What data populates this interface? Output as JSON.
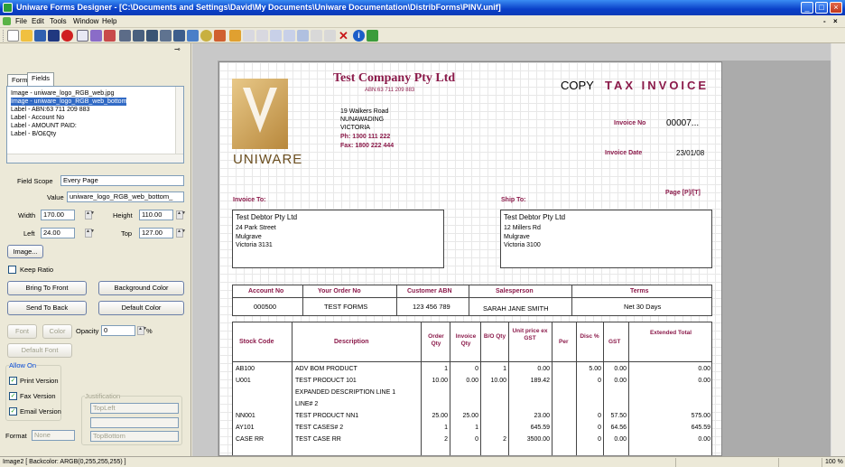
{
  "window": {
    "title": "Uniware Forms Designer - [C:\\Documents and Settings\\David\\My Documents\\Uniware Documentation\\DistribForms\\PINV.unif]",
    "min": "_",
    "max": "□",
    "close": "×"
  },
  "menu": {
    "items": [
      "File",
      "Edit",
      "Tools",
      "Window",
      "Help"
    ],
    "mdi_minimize": "-",
    "mdi_close": "×"
  },
  "toolbar": {
    "icons": [
      "new-icon",
      "open-icon",
      "save-icon",
      "save-as-icon",
      "delete-icon",
      "print-preview-icon",
      "cut-icon",
      "print-icon",
      "field-icon",
      "grid-icon",
      "table-icon",
      "label-icon",
      "image-icon",
      "chart-icon",
      "compass-icon",
      "align-icon",
      "pointer-icon",
      "undo-icon",
      "redo-icon",
      "zoom-in-icon",
      "zoom-out-icon",
      "wand-icon",
      "copy-icon",
      "paste-icon",
      "delete-x-icon",
      "info-icon",
      "exit-icon"
    ]
  },
  "colors": {
    "accent": "#8b1a4a",
    "selection": "#316ac5",
    "title_bar": "#0a3fc8"
  },
  "panel": {
    "tabs": [
      "Form",
      "Fields"
    ],
    "fields": [
      "Image - uniware_logo_RGB_web.jpg",
      "Image - uniware_logo_RGB_web_bottom",
      "Label - ABN:63 711 209 883",
      "Label - Account No",
      "Label - AMOUNT PAID:",
      "Label - B/O£Qty"
    ],
    "selected_field_index": 1,
    "field_scope_label": "Field Scope",
    "field_scope": "Every Page",
    "value_label": "Value",
    "value": "uniware_logo_RGB_web_bottom_",
    "width_label": "Width",
    "width": "170.00",
    "height_label": "Height",
    "height": "110.00",
    "left_label": "Left",
    "left": "24.00",
    "top_label": "Top",
    "top": "127.00",
    "image_button": "Image...",
    "keep_ratio": "Keep Ratio",
    "bring_front": "Bring To Front",
    "background_color": "Background Color",
    "send_back": "Send To Back",
    "default_color": "Default Color",
    "font": "Font",
    "color": "Color",
    "opacity_label": "Opacity",
    "opacity": "0",
    "percent": "%",
    "default_font": "Default Font",
    "allow_on": "Allow On",
    "print_version": "Print Version",
    "fax_version": "Fax Version",
    "email_version": "Email Version",
    "justification": "Justification",
    "just_h": "TopLeft",
    "just_v": "TopBottom",
    "format_label": "Format",
    "format": "None"
  },
  "invoice": {
    "company": "Test Company Pty Ltd",
    "abn": "ABN:63 711 209 883",
    "address": [
      "19 Walkers Road",
      "NUNAWADING",
      "VICTORIA"
    ],
    "phone": "Ph: 1300 111 222",
    "fax": "Fax: 1800 222 444",
    "logo_text": "UNIWARE",
    "copy": "COPY",
    "doc_title": "TAX INVOICE",
    "invoice_no_label": "Invoice No",
    "invoice_no": "00007...",
    "invoice_date_label": "Invoice Date",
    "invoice_date": "23/01/08",
    "page": "Page [P]/[T]",
    "invoice_to_label": "Invoice To:",
    "invoice_to": [
      "Test Debtor Pty Ltd",
      "24 Park Street",
      "Mulgrave",
      "Victoria  3131"
    ],
    "ship_to_label": "Ship To:",
    "ship_to": [
      "Test Debtor Pty Ltd",
      "12 Millers Rd",
      "Mulgrave",
      "Victoria  3100"
    ],
    "summary_headers": [
      "Account No",
      "Your Order No",
      "Customer ABN",
      "Salesperson",
      "Terms"
    ],
    "summary_values": [
      "000500",
      "TEST FORMS",
      "123 456 789",
      "SARAH JANE SMITH",
      "Net 30 Days"
    ],
    "columns": [
      "Stock Code",
      "Description",
      "Order Qty",
      "Invoice Qty",
      "B/O Qty",
      "Unit price ex GST",
      "Per",
      "Disc %",
      "GST",
      "Extended Total"
    ],
    "rows": [
      [
        "AB100",
        "ADV BOM PRODUCT",
        "1",
        "0",
        "1",
        "0.00",
        "",
        "5.00",
        "0.00",
        "0.00"
      ],
      [
        "U001",
        "TEST PRODUCT 101",
        "10.00",
        "0.00",
        "10.00",
        "189.42",
        "",
        "0",
        "0.00",
        "0.00"
      ],
      [
        "",
        "EXPANDED DESCRIPTION LINE 1",
        "",
        "",
        "",
        "",
        "",
        "",
        "",
        ""
      ],
      [
        "",
        "LINE# 2",
        "",
        "",
        "",
        "",
        "",
        "",
        "",
        ""
      ],
      [
        "NN001",
        "TEST PRODUCT NN1",
        "25.00",
        "25.00",
        "",
        "23.00",
        "",
        "0",
        "57.50",
        "575.00"
      ],
      [
        "AY101",
        "TEST CASES# 2",
        "1",
        "1",
        "",
        "645.59",
        "",
        "0",
        "64.56",
        "645.59"
      ],
      [
        "CASE RR",
        "TEST CASE RR",
        "2",
        "0",
        "2",
        "3500.00",
        "",
        "0",
        "0.00",
        "0.00"
      ]
    ]
  },
  "status": {
    "text": "Image2 [ Backcolor: ARGB(0,255,255,255) ]",
    "zoom": "100 %"
  }
}
